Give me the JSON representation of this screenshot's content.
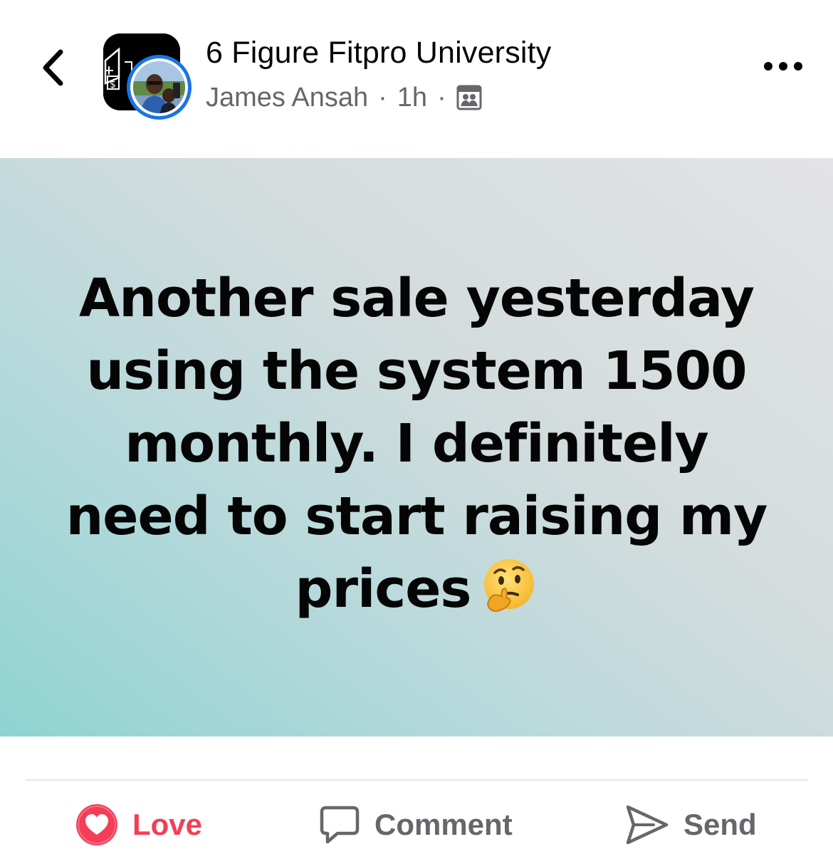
{
  "header": {
    "back_icon": "chevron-left-icon",
    "group_name": "6 Figure Fitpro University",
    "author": "James Ansah",
    "separator": "·",
    "time": "1h",
    "privacy_icon": "group-members-icon",
    "more_icon": "more-horizontal-icon"
  },
  "post": {
    "text": "Another sale yesterday using the system 1500 monthly. I definitely need to start raising my prices",
    "emoji_icon": "thinking-face-emoji",
    "background_colors": [
      "#8fd3d2",
      "#e3e3e5"
    ]
  },
  "actions": {
    "love_label": "Love",
    "comment_label": "Comment",
    "send_label": "Send",
    "love_color": "#f33e58",
    "muted_color": "#65676b"
  }
}
